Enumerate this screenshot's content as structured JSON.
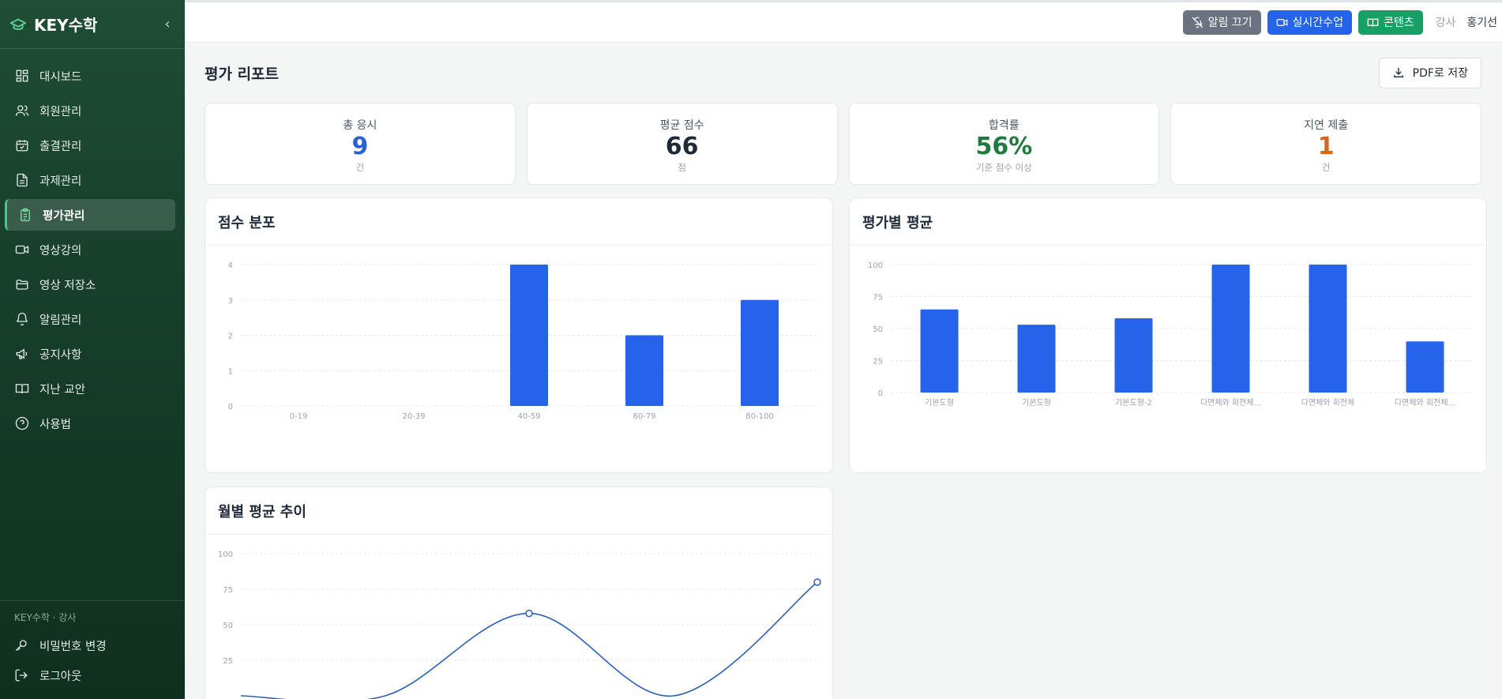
{
  "app": {
    "brand": "KEY수학",
    "collapse_icon": "chevron-left-icon"
  },
  "sidebar": {
    "items": [
      {
        "label": "대시보드",
        "icon": "dashboard-icon",
        "active": false
      },
      {
        "label": "회원관리",
        "icon": "users-icon",
        "active": false
      },
      {
        "label": "출결관리",
        "icon": "calendar-check-icon",
        "active": false
      },
      {
        "label": "과제관리",
        "icon": "file-text-icon",
        "active": false
      },
      {
        "label": "평가관리",
        "icon": "clipboard-icon",
        "active": true
      },
      {
        "label": "영상강의",
        "icon": "video-icon",
        "active": false
      },
      {
        "label": "영상 저장소",
        "icon": "folder-icon",
        "active": false
      },
      {
        "label": "알림관리",
        "icon": "bell-icon",
        "active": false
      },
      {
        "label": "공지사항",
        "icon": "megaphone-icon",
        "active": false
      },
      {
        "label": "지난 교안",
        "icon": "book-icon",
        "active": false
      },
      {
        "label": "사용법",
        "icon": "help-circle-icon",
        "active": false
      }
    ],
    "footer_caption": "KEY수학 · 강사",
    "footer_items": [
      {
        "label": "비밀번호 변경",
        "icon": "key-icon"
      },
      {
        "label": "로그아웃",
        "icon": "logout-icon"
      }
    ]
  },
  "topbar": {
    "mute_label": "알림 끄기",
    "live_label": "실시간수업",
    "content_label": "콘텐츠",
    "role": "강사",
    "user": "홍기선"
  },
  "page": {
    "title": "평가 리포트",
    "pdf_label": "PDF로 저장"
  },
  "stats": [
    {
      "label": "총 응시",
      "value": "9",
      "unit": "건",
      "color": "#2b5fd6"
    },
    {
      "label": "평균 점수",
      "value": "66",
      "unit": "점",
      "color": "#1f2937"
    },
    {
      "label": "합격률",
      "value": "56%",
      "unit": "기준 점수 이상",
      "color": "#1f7a3f"
    },
    {
      "label": "지연 제출",
      "value": "1",
      "unit": "건",
      "color": "#d2691e"
    }
  ],
  "colors": {
    "bar": "#2563eb",
    "line": "#2b5fb5",
    "grid": "#e5e7eb",
    "axis_text": "#9aa3ad"
  },
  "chart_data": [
    {
      "type": "bar",
      "title": "점수 분포",
      "categories": [
        "0-19",
        "20-39",
        "40-59",
        "60-79",
        "80-100"
      ],
      "values": [
        0,
        0,
        4,
        2,
        3
      ],
      "ylim": [
        0,
        4
      ],
      "yticks": [
        0,
        1,
        2,
        3,
        4
      ],
      "grid": true
    },
    {
      "type": "bar",
      "title": "평가별 평균",
      "categories": [
        "기본도형",
        "기본도형",
        "기본도형-2",
        "다면체와 회전체...",
        "다면체와 회전체",
        "다면체와 회전체..."
      ],
      "values": [
        65,
        53,
        58,
        100,
        100,
        40
      ],
      "ylim": [
        0,
        100
      ],
      "yticks": [
        0,
        25,
        50,
        75,
        100
      ],
      "grid": true
    },
    {
      "type": "line",
      "title": "월별 평균 추이",
      "values": [
        0,
        0,
        58,
        0,
        80
      ],
      "visible_points": [
        {
          "index": 2,
          "value": 58
        },
        {
          "index": 4,
          "value": 80
        }
      ],
      "ylim": [
        0,
        100
      ],
      "yticks": [
        25,
        50,
        75,
        100
      ],
      "grid": true
    }
  ]
}
